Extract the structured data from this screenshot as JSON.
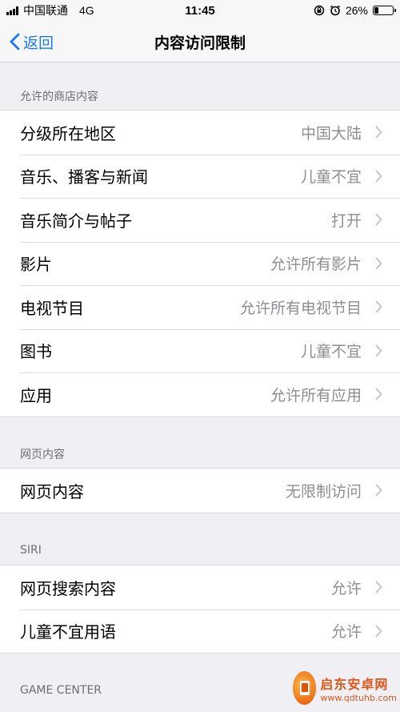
{
  "status_bar": {
    "carrier": "中国联通",
    "network": "4G",
    "time": "11:45",
    "battery_percent": "26%",
    "battery_level": 0.26
  },
  "nav": {
    "back_label": "返回",
    "title": "内容访问限制"
  },
  "sections": [
    {
      "header": "允许的商店内容",
      "rows": [
        {
          "label": "分级所在地区",
          "value": "中国大陆"
        },
        {
          "label": "音乐、播客与新闻",
          "value": "儿童不宜"
        },
        {
          "label": "音乐简介与帖子",
          "value": "打开"
        },
        {
          "label": "影片",
          "value": "允许所有影片"
        },
        {
          "label": "电视节目",
          "value": "允许所有电视节目"
        },
        {
          "label": "图书",
          "value": "儿童不宜"
        },
        {
          "label": "应用",
          "value": "允许所有应用"
        }
      ]
    },
    {
      "header": "网页内容",
      "rows": [
        {
          "label": "网页内容",
          "value": "无限制访问"
        }
      ]
    },
    {
      "header": "SIRI",
      "rows": [
        {
          "label": "网页搜索内容",
          "value": "允许"
        },
        {
          "label": "儿童不宜用语",
          "value": "允许"
        }
      ]
    },
    {
      "header": "GAME CENTER",
      "rows": []
    }
  ],
  "watermark": {
    "main": "启东安卓网",
    "sub": "www.qdtuhb.com"
  },
  "colors": {
    "accent": "#1a7cf5",
    "background": "#efeff4",
    "secondary_text": "#8e8e93",
    "watermark": "#e0561b"
  }
}
